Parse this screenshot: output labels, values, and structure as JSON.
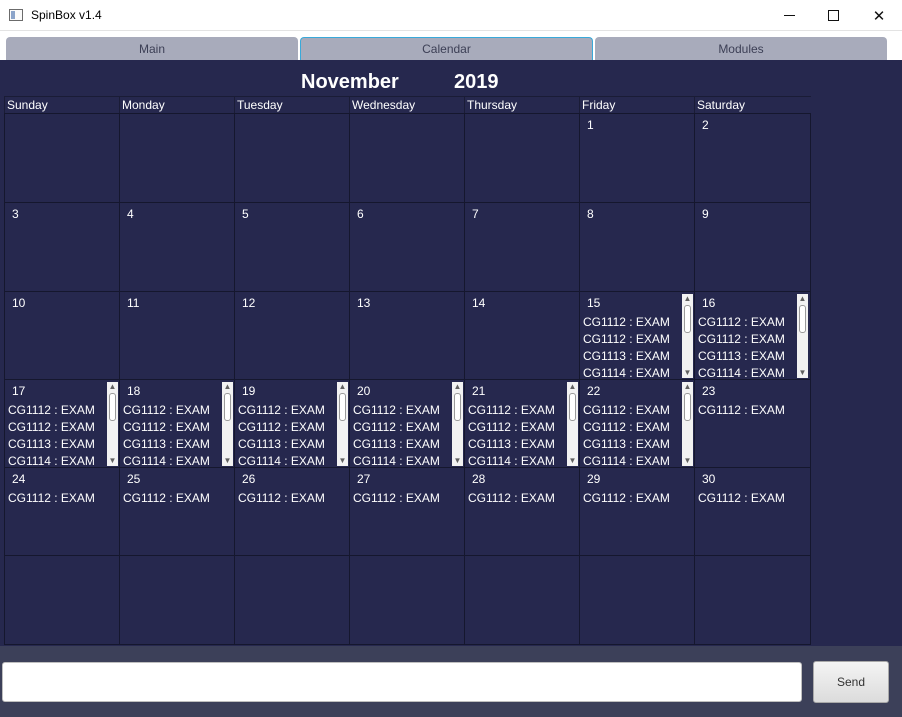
{
  "window": {
    "title": "SpinBox v1.4",
    "close_glyph": "✕"
  },
  "tabs": [
    {
      "label": "Main"
    },
    {
      "label": "Calendar",
      "selected": true
    },
    {
      "label": "Modules"
    }
  ],
  "calendar": {
    "month": "November",
    "year": "2019",
    "weekdays": [
      "Sunday",
      "Monday",
      "Tuesday",
      "Wednesday",
      "Thursday",
      "Friday",
      "Saturday"
    ],
    "weeks": [
      [
        {
          "day": ""
        },
        {
          "day": ""
        },
        {
          "day": ""
        },
        {
          "day": ""
        },
        {
          "day": ""
        },
        {
          "day": "1"
        },
        {
          "day": "2"
        }
      ],
      [
        {
          "day": "3"
        },
        {
          "day": "4"
        },
        {
          "day": "5"
        },
        {
          "day": "6"
        },
        {
          "day": "7"
        },
        {
          "day": "8"
        },
        {
          "day": "9"
        }
      ],
      [
        {
          "day": "10"
        },
        {
          "day": "11"
        },
        {
          "day": "12"
        },
        {
          "day": "13"
        },
        {
          "day": "14"
        },
        {
          "day": "15",
          "events": [
            "CG1112 : EXAM",
            "CG1112 : EXAM",
            "CG1113 : EXAM",
            "CG1114 : EXAM"
          ],
          "scroll": true
        },
        {
          "day": "16",
          "events": [
            "CG1112 : EXAM",
            "CG1112 : EXAM",
            "CG1113 : EXAM",
            "CG1114 : EXAM"
          ],
          "scroll": true
        }
      ],
      [
        {
          "day": "17",
          "events": [
            "CG1112 : EXAM",
            "CG1112 : EXAM",
            "CG1113 : EXAM",
            "CG1114 : EXAM"
          ],
          "scroll": true
        },
        {
          "day": "18",
          "events": [
            "CG1112 : EXAM",
            "CG1112 : EXAM",
            "CG1113 : EXAM",
            "CG1114 : EXAM"
          ],
          "scroll": true
        },
        {
          "day": "19",
          "events": [
            "CG1112 : EXAM",
            "CG1112 : EXAM",
            "CG1113 : EXAM",
            "CG1114 : EXAM"
          ],
          "scroll": true
        },
        {
          "day": "20",
          "events": [
            "CG1112 : EXAM",
            "CG1112 : EXAM",
            "CG1113 : EXAM",
            "CG1114 : EXAM"
          ],
          "scroll": true
        },
        {
          "day": "21",
          "events": [
            "CG1112 : EXAM",
            "CG1112 : EXAM",
            "CG1113 : EXAM",
            "CG1114 : EXAM"
          ],
          "scroll": true
        },
        {
          "day": "22",
          "events": [
            "CG1112 : EXAM",
            "CG1112 : EXAM",
            "CG1113 : EXAM",
            "CG1114 : EXAM"
          ],
          "scroll": true
        },
        {
          "day": "23",
          "events": [
            "CG1112 : EXAM"
          ]
        }
      ],
      [
        {
          "day": "24",
          "events": [
            "CG1112 : EXAM"
          ]
        },
        {
          "day": "25",
          "events": [
            "CG1112 : EXAM"
          ]
        },
        {
          "day": "26",
          "events": [
            "CG1112 : EXAM"
          ]
        },
        {
          "day": "27",
          "events": [
            "CG1112 : EXAM"
          ]
        },
        {
          "day": "28",
          "events": [
            "CG1112 : EXAM"
          ]
        },
        {
          "day": "29",
          "events": [
            "CG1112 : EXAM"
          ]
        },
        {
          "day": "30",
          "events": [
            "CG1112 : EXAM"
          ]
        }
      ],
      [
        {
          "day": ""
        },
        {
          "day": ""
        },
        {
          "day": ""
        },
        {
          "day": ""
        },
        {
          "day": ""
        },
        {
          "day": ""
        },
        {
          "day": ""
        }
      ]
    ]
  },
  "command": {
    "value": "",
    "placeholder": "",
    "send_label": "Send"
  },
  "icons": {
    "app": "app-window-icon",
    "scroll_up": "▲",
    "scroll_down": "▼"
  },
  "colors": {
    "calendar_bg": "#26284e",
    "frame_bg": "#3c4059",
    "tab_bg": "#a8abbb",
    "tab_focus": "#39a9d9"
  }
}
